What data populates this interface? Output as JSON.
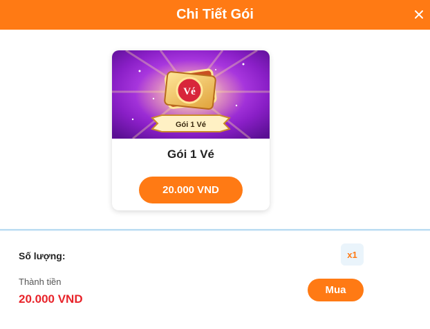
{
  "header": {
    "title": "Chi Tiết Gói",
    "close_icon": "close-icon"
  },
  "package": {
    "image_icon": "ticket-package-image",
    "image_badge_text": "Vé",
    "image_ribbon_text": "Gói 1 Vé",
    "name": "Gói 1 Vé",
    "price": "20.000 VND"
  },
  "summary": {
    "quantity_label": "Số lượng:",
    "quantity_value": "x1",
    "total_label": "Thành tiền",
    "total_value": "20.000 VND",
    "buy_label": "Mua"
  },
  "colors": {
    "accent": "#ff7a14",
    "price_red": "#e8242b",
    "card_purple": "#8a1fc7"
  }
}
